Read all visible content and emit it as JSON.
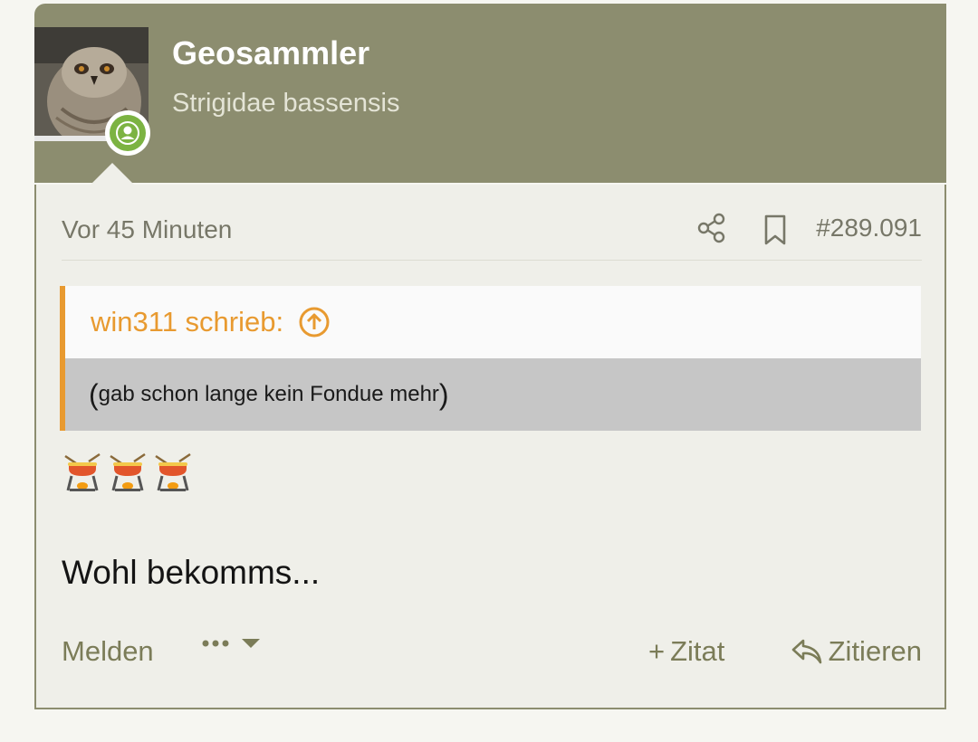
{
  "author": {
    "name": "Geosammler",
    "title": "Strigidae bassensis",
    "avatar_icon": "owl-photo",
    "status_icon": "online-user-icon",
    "status_color": "#7cb342"
  },
  "post": {
    "timestamp": "Vor 45 Minuten",
    "number": "#289.091",
    "quote": {
      "author_line": "win311 schrieb:",
      "text": "gab schon lange kein Fondue mehr",
      "open_paren": "(",
      "close_paren": ")"
    },
    "emoji": [
      "🫕",
      "🫕",
      "🫕"
    ],
    "text": "Wohl bekomms..."
  },
  "actions": {
    "report": "Melden",
    "more_icon": "more-dots-icon",
    "quote_add": "Zitat",
    "quote_add_symbol": "+",
    "reply": "Zitieren"
  },
  "colors": {
    "header_bg": "#8c8d6f",
    "accent_orange": "#e89a30",
    "action_olive": "#7b7c58"
  }
}
